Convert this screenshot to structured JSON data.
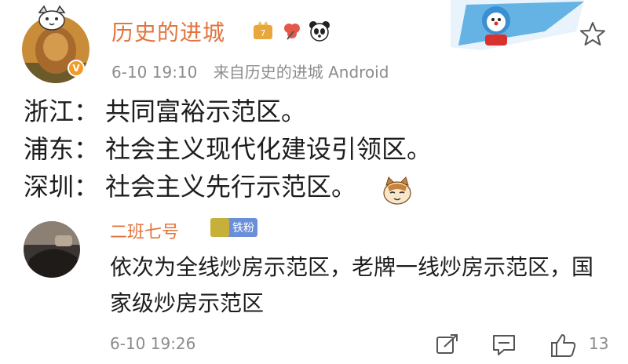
{
  "post": {
    "username": "历史的进城",
    "time": "6-10 19:10",
    "source": "来自历史的进城 Android",
    "lines": [
      {
        "place": "浙江：",
        "text": "共同富裕示范区。"
      },
      {
        "place": "浦东：",
        "text": "社会主义现代化建设引领区。"
      },
      {
        "place": "深圳：",
        "text": "社会主义先行示范区。"
      }
    ],
    "badges": [
      "membership-badge-icon",
      "flower-badge-icon",
      "panda-badge-icon"
    ],
    "verified_label": "V"
  },
  "comment": {
    "username": "二班七号",
    "badge_label": "铁粉",
    "text": "依次为全线炒房示范区，老牌一线炒房示范区，国家级炒房示范区",
    "time": "6-10 19:26",
    "like_count": "13"
  },
  "colors": {
    "username": "#e2743e",
    "meta": "#8c8c8c",
    "text": "#1d1d1d",
    "fan_badge": "#6a8fd8"
  }
}
